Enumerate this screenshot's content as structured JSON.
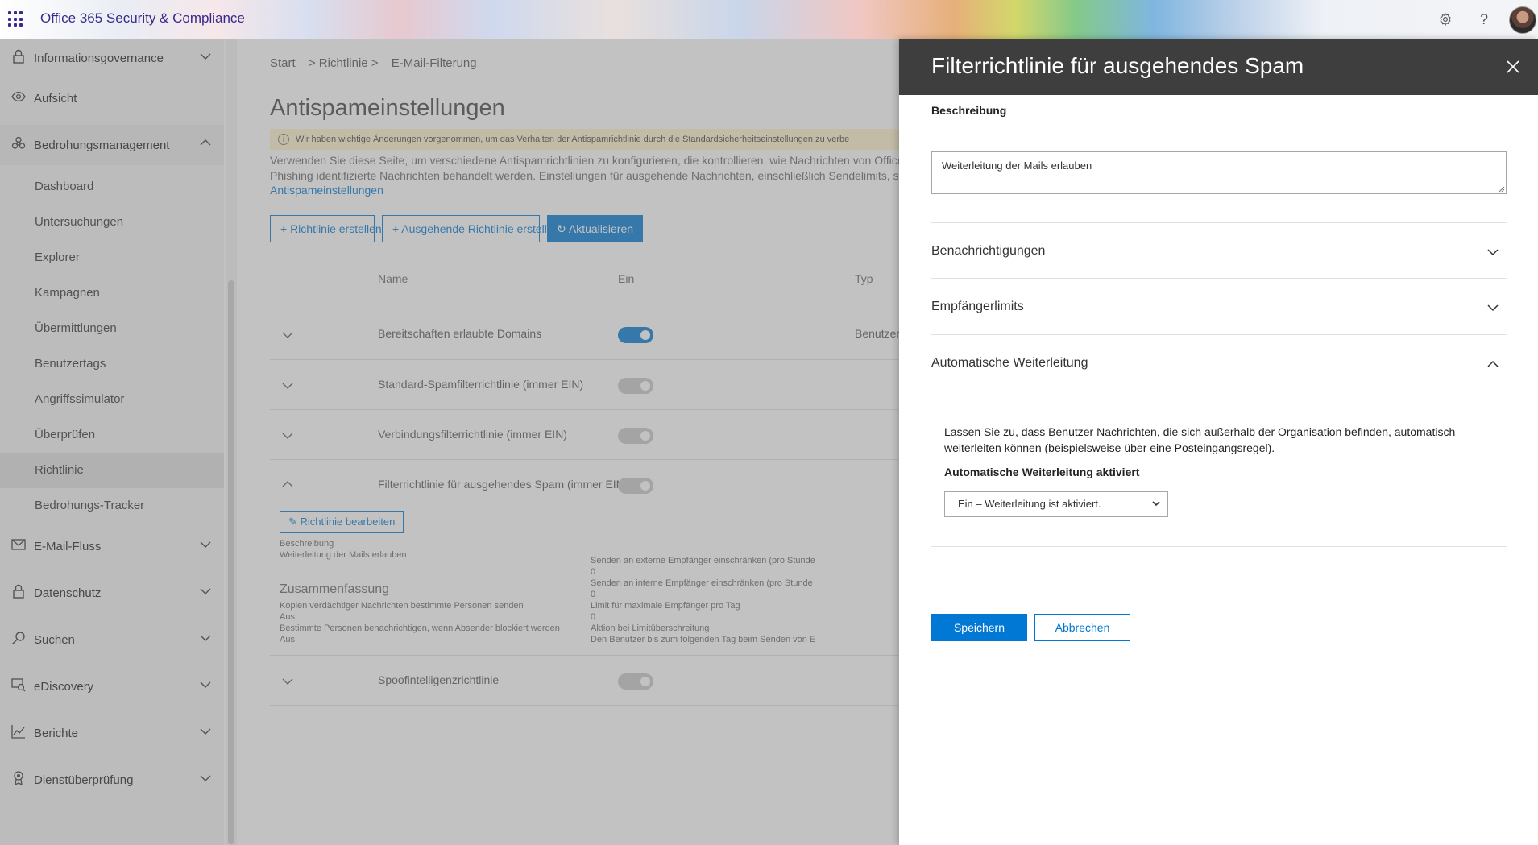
{
  "header": {
    "app_title": "Office 365 Security & Compliance",
    "icons": [
      "waffle-icon",
      "gear-icon",
      "help-icon",
      "avatar"
    ]
  },
  "nav": {
    "top_items": [
      {
        "label": "Informationsgovernance",
        "icon": "lock-icon"
      },
      {
        "label": "Aufsicht",
        "icon": "eye-icon"
      },
      {
        "label": "Bedrohungsmanagement",
        "icon": "biohazard-icon"
      }
    ],
    "sub_items": [
      "Dashboard",
      "Untersuchungen",
      "Explorer",
      "Kampagnen",
      "Übermittlungen",
      "Benutzertags",
      "Angriffssimulator",
      "Überprüfen",
      "Richtlinie",
      "Bedrohungs-Tracker"
    ],
    "active_sub": "Richtlinie",
    "bottom_items": [
      {
        "label": "E-Mail-Fluss",
        "icon": "mail-icon"
      },
      {
        "label": "Datenschutz",
        "icon": "lock-icon"
      },
      {
        "label": "Suchen",
        "icon": "search-icon"
      },
      {
        "label": "eDiscovery",
        "icon": "ediscovery-icon"
      },
      {
        "label": "Berichte",
        "icon": "chart-icon"
      },
      {
        "label": "Dienstüberprüfung",
        "icon": "badge-icon"
      }
    ]
  },
  "main": {
    "breadcrumb": [
      "Start",
      "> Richtlinie >",
      "E-Mail-Filterung"
    ],
    "title": "Antispameinstellungen",
    "notice": "Wir haben wichtige Änderungen vorgenommen, um das Verhalten der Antispamrichtlinie durch die Standardsicherheitseinstellungen zu verbe",
    "intro_line1": "Verwenden Sie diese Seite, um verschiedene Antispamrichtlinien zu konfigurieren, die kontrollieren, wie Nachrichten von Office",
    "intro_line2": "Phishing identifizierte Nachrichten behandelt werden. Einstellungen für ausgehende Nachrichten, einschließlich Sendelimits, so",
    "intro_link": "Antispameinstellungen",
    "buttons": {
      "create": "+ Richtlinie erstellen",
      "create_outbound": "+ Ausgehende Richtlinie erstellen",
      "refresh": "Aktualisieren"
    },
    "columns": {
      "name": "Name",
      "on": "Ein",
      "type": "Typ"
    },
    "rows": [
      {
        "name": "Bereitschaften erlaubte Domains",
        "on": true,
        "type": "Benutzer"
      },
      {
        "name": "Standard-Spamfilterrichtlinie (immer EIN)",
        "on": false,
        "type": ""
      },
      {
        "name": "Verbindungsfilterrichtlinie (immer EIN)",
        "on": false,
        "type": ""
      },
      {
        "name": "Filterrichtlinie für ausgehendes Spam (immer EIN)",
        "on": false,
        "type": ""
      },
      {
        "name": "Spoofintelligenzrichtlinie",
        "on": false,
        "type": ""
      }
    ],
    "expanded": {
      "edit_button": "Richtlinie bearbeiten",
      "desc_label": "Beschreibung",
      "desc_value": "Weiterleitung der Mails erlauben",
      "summary_title": "Zusammenfassung",
      "left": [
        "Kopien verdächtiger Nachrichten bestimmte Personen senden",
        "Aus",
        "Bestimmte Personen benachrichtigen, wenn Absender blockiert werden",
        "Aus"
      ],
      "right": [
        "Senden an externe Empfänger einschränken (pro Stunde",
        "0",
        "Senden an interne Empfänger einschränken (pro Stunde",
        "0",
        "Limit für maximale Empfänger pro Tag",
        "0",
        "Aktion bei Limitüberschreitung",
        "Den Benutzer bis zum folgenden Tag beim Senden von E"
      ]
    }
  },
  "panel": {
    "title": "Filterrichtlinie für ausgehendes Spam",
    "desc_label": "Beschreibung",
    "desc_value": "Weiterleitung der Mails erlauben",
    "sections": [
      "Benachrichtigungen",
      "Empfängerlimits",
      "Automatische Weiterleitung"
    ],
    "auto_forward_text": "Lassen Sie zu, dass Benutzer Nachrichten, die sich außerhalb der Organisation befinden, automatisch weiterleiten können (beispielsweise über eine Posteingangsregel).",
    "auto_forward_label": "Automatische Weiterleitung aktiviert",
    "auto_forward_value": "Ein – Weiterleitung ist aktiviert.",
    "save": "Speichern",
    "cancel": "Abbrechen"
  },
  "colors": {
    "accent": "#0078d4",
    "panel_header": "#3e3e3e",
    "brand": "#3b2a8c"
  }
}
